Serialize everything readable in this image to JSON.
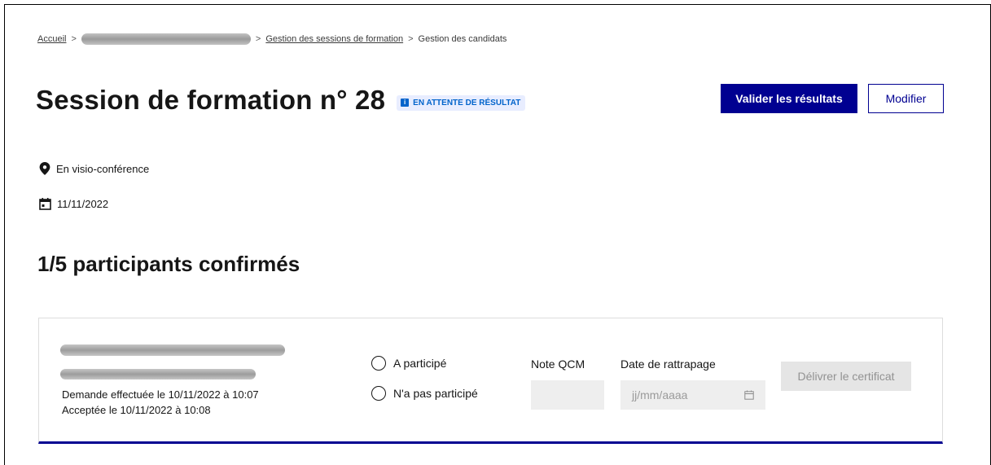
{
  "breadcrumb": {
    "home": "Accueil",
    "sessions": "Gestion des sessions de formation",
    "current": "Gestion des candidats",
    "separator": ">"
  },
  "header": {
    "title": "Session de formation n° 28",
    "status_badge": "EN ATTENTE DE RÉSULTAT",
    "badge_icon": "i",
    "validate_label": "Valider les résultats",
    "edit_label": "Modifier"
  },
  "session_info": {
    "location": "En visio-conférence",
    "date": "11/11/2022"
  },
  "participants": {
    "heading": "1/5 participants confirmés",
    "items": [
      {
        "request_text": "Demande effectuée le 10/11/2022 à 10:07",
        "accepted_text": "Acceptée le 10/11/2022 à 10:08",
        "radio_participated": "A participé",
        "radio_not_participated": "N'a pas participé",
        "qcm_label": "Note QCM",
        "qcm_value": "",
        "retake_label": "Date de rattrapage",
        "retake_placeholder": "jj/mm/aaaa",
        "certificate_label": "Délivrer le certificat"
      }
    ]
  },
  "colors": {
    "primary": "#000091",
    "badge_bg": "#e8edff",
    "badge_text": "#0063cb",
    "disabled_bg": "#e5e5e5"
  }
}
